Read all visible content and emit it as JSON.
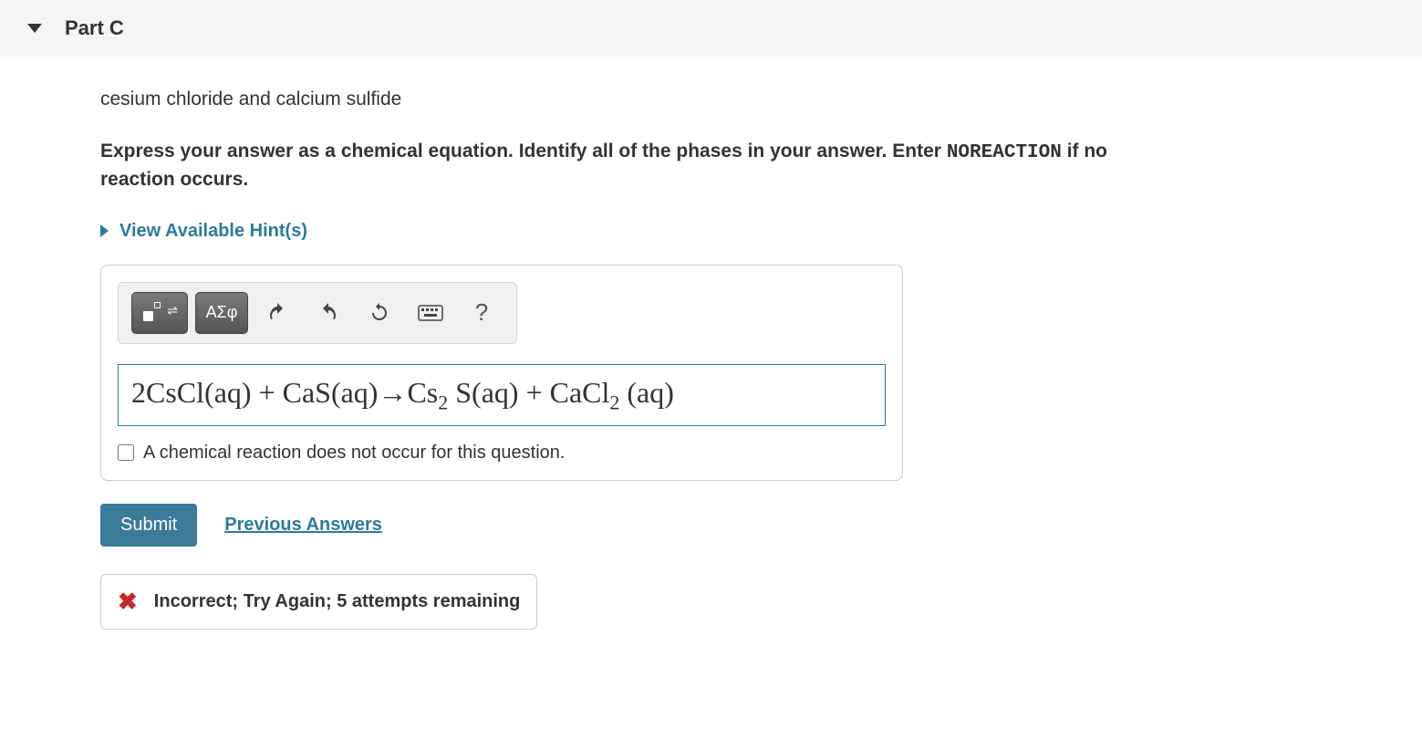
{
  "header": {
    "part_title": "Part C"
  },
  "question": {
    "text": "cesium chloride and calcium sulfide",
    "instructions_pre": "Express your answer as a chemical equation. Identify all of the phases in your answer. Enter ",
    "instructions_mono": "NOREACTION",
    "instructions_post": " if no reaction occurs."
  },
  "hints": {
    "label": "View Available Hint(s)"
  },
  "toolbar": {
    "greek_label": "ΑΣφ",
    "help_label": "?"
  },
  "answer": {
    "equation_html": "2CsCl(aq) + CaS(aq)→Cs<sub>2</sub> S(aq) + CaCl<sub>2</sub> (aq)",
    "checkbox_label": "A chemical reaction does not occur for this question."
  },
  "actions": {
    "submit_label": "Submit",
    "previous_answers_label": "Previous Answers"
  },
  "feedback": {
    "text": "Incorrect; Try Again; 5 attempts remaining"
  }
}
